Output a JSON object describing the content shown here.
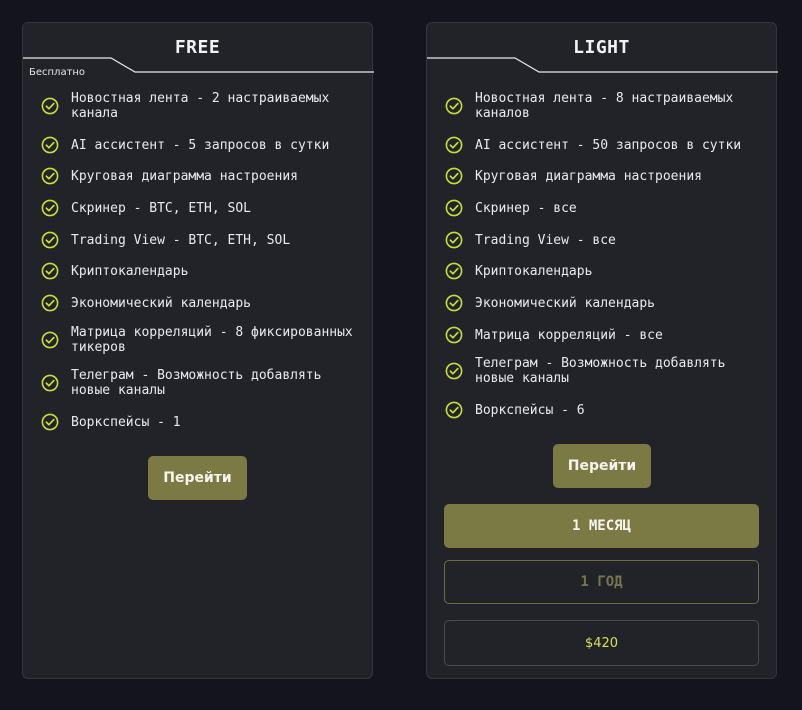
{
  "colors": {
    "background": "#14141c",
    "card": "#222229",
    "accent": "#7b7a44",
    "check": "#c9dd3c",
    "price": "#d6e05a"
  },
  "plans": [
    {
      "title": "FREE",
      "subtitle": "Бесплатно",
      "features": [
        "Новостная лента - 2 настраиваемых канала",
        "AI ассистент - 5 запросов в сутки",
        "Круговая диаграмма настроения",
        "Скринер - BTC, ETH, SOL",
        "Trading View - BTC, ETH, SOL",
        "Криптокалендарь",
        "Экономический календарь",
        "Матрица корреляций - 8 фиксированных тикеров",
        "Телеграм - Возможность добавлять новые каналы",
        "Воркспейсы - 1"
      ],
      "button_label": "Перейти"
    },
    {
      "title": "LIGHT",
      "features": [
        "Новостная лента - 8 настраиваемых каналов",
        "AI ассистент - 50 запросов в сутки",
        "Круговая диаграмма настроения",
        "Скринер - все",
        "Trading View - все",
        "Криптокалендарь",
        "Экономический календарь",
        "Матрица корреляций - все",
        "Телеграм - Возможность добавлять новые каналы",
        "Воркспейсы - 6"
      ],
      "button_label": "Перейти",
      "periods": [
        "1 МЕСЯЦ",
        "1 ГОД"
      ],
      "price": "$420"
    }
  ]
}
